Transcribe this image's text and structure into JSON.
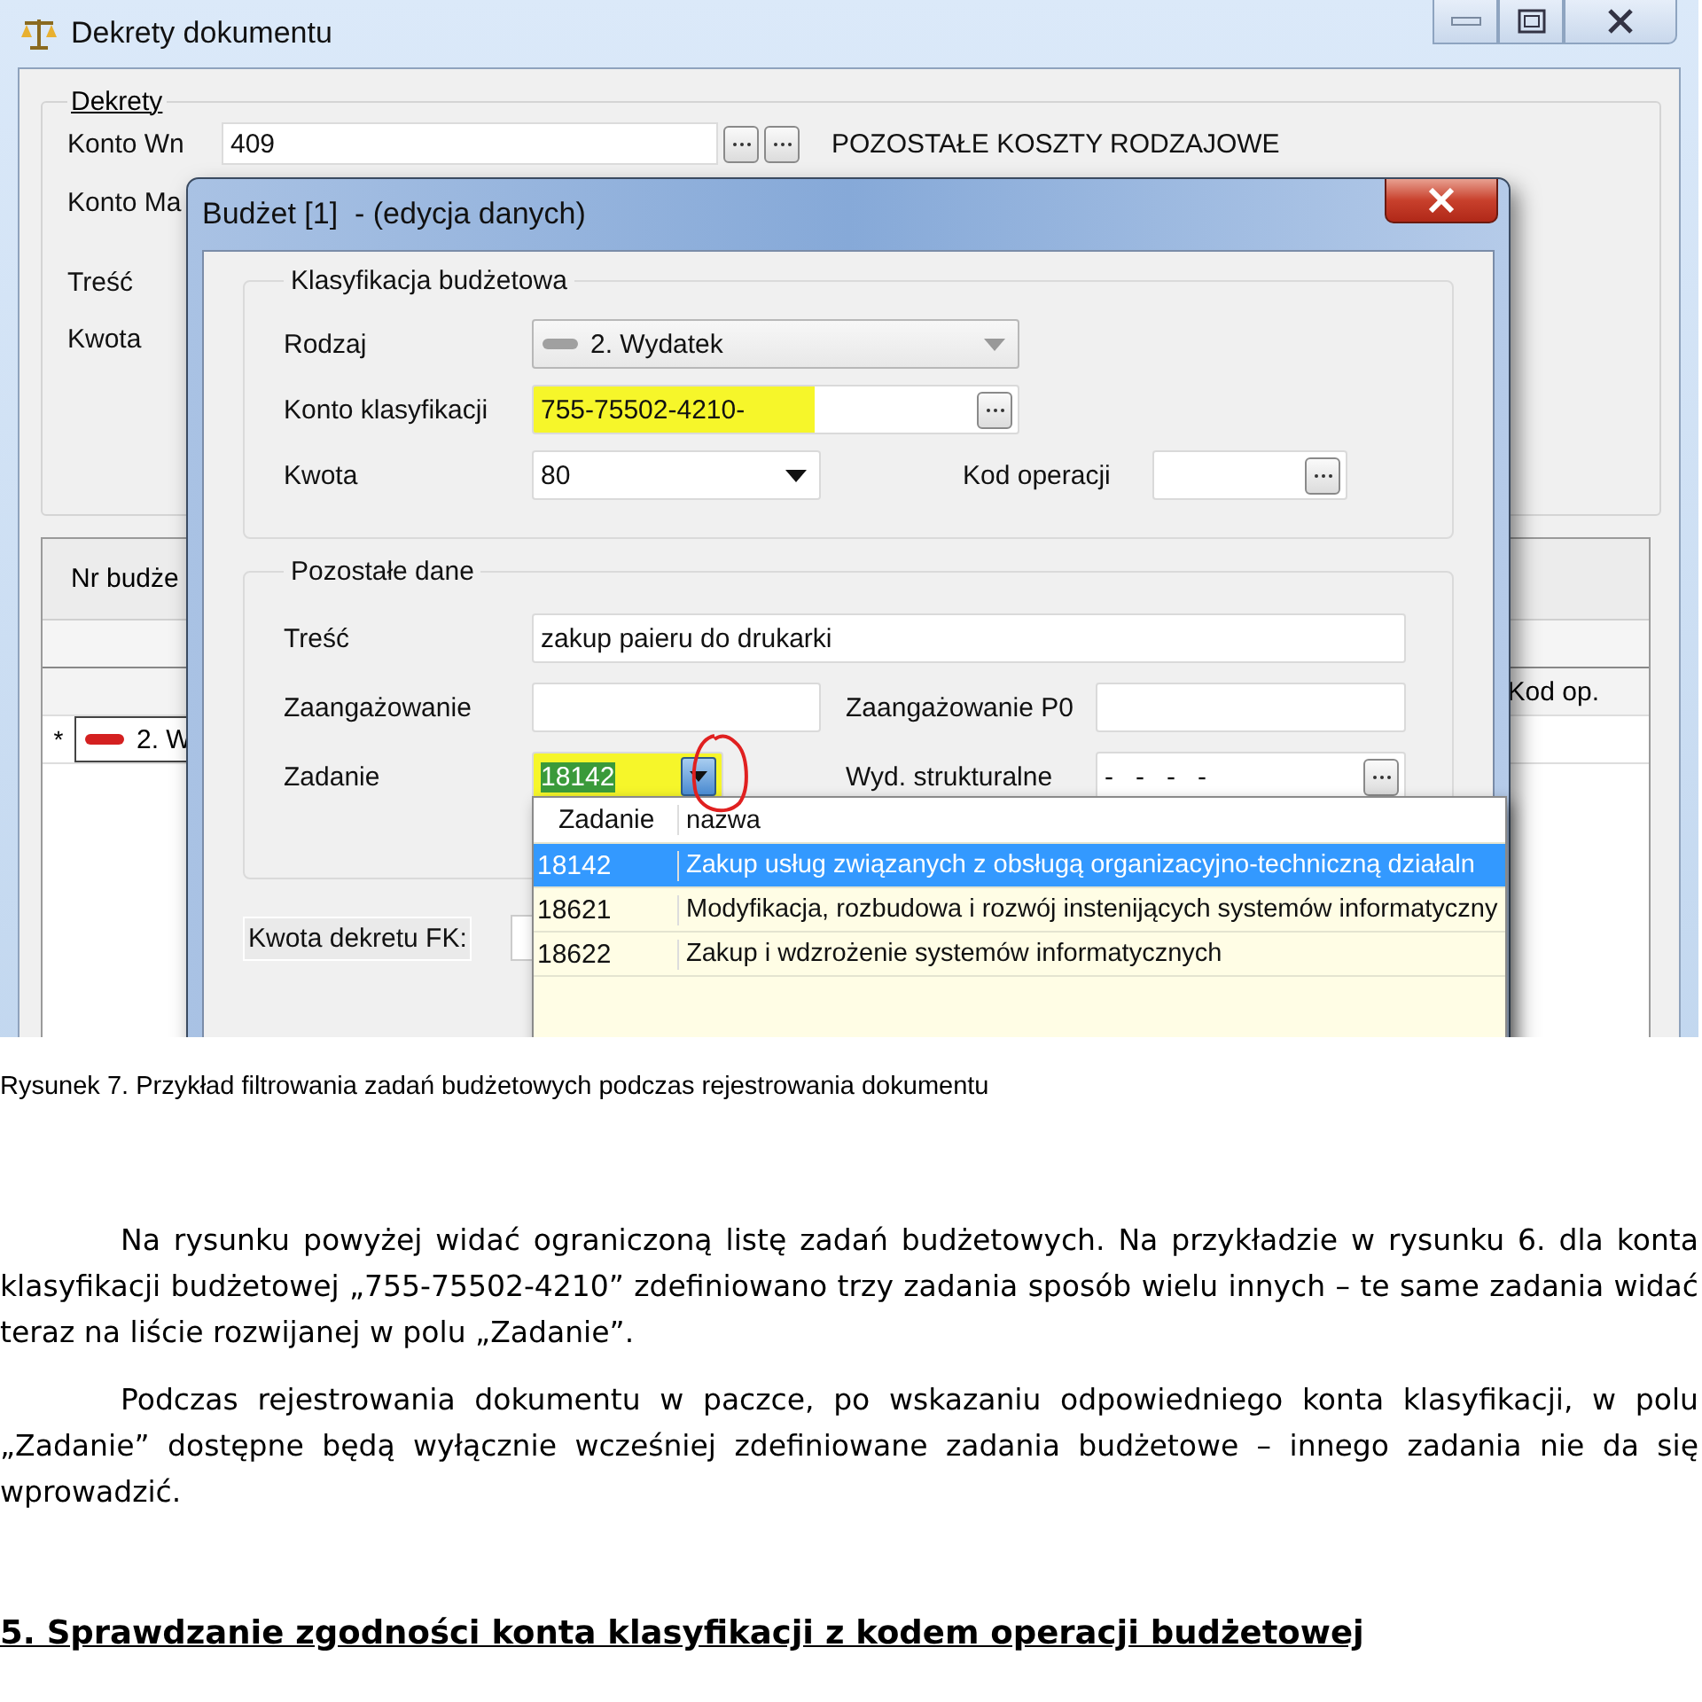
{
  "main_window": {
    "title": "Dekrety dokumentu",
    "group_title": "Dekrety",
    "labels": [
      "Konto Wn",
      "Konto Ma",
      "Treść",
      "Kwota"
    ],
    "konto_wn": "409",
    "konto_wn_name": "POZOSTAŁE KOSZTY RODZAJOWE",
    "grid": {
      "column_1": "Nr budże",
      "column_2": "Kod op.",
      "row_marker": "*",
      "row_cell": "2. W"
    }
  },
  "dialog": {
    "title": "Budżet [1]  - (edycja danych)",
    "sections": [
      {
        "title": "Klasyfikacja budżetowa",
        "rows": [
          {
            "label": "Rodzaj",
            "field": {
              "kind": "icon_combo",
              "value": "2. Wydatek",
              "disabled": true
            }
          },
          {
            "label": "Konto klasyfikacji",
            "field": {
              "kind": "lookup",
              "value": "755-75502-4210-",
              "highlighted": true
            }
          },
          {
            "label": "Kwota",
            "field": {
              "kind": "combo",
              "value": "80"
            },
            "label_2": "Kod operacji",
            "field_2": {
              "kind": "lookup"
            }
          }
        ]
      },
      {
        "title": "Pozostałe dane",
        "rows": [
          {
            "label": "Treść",
            "field": {
              "kind": "text",
              "value": "zakup paieru do drukarki"
            }
          },
          {
            "label": "Zaangażowanie",
            "field": {
              "kind": "text"
            },
            "label_2": "Zaangażowanie P0",
            "field_2": {
              "kind": "text"
            }
          },
          {
            "label": "Zadanie",
            "field": {
              "kind": "combo",
              "value": "18142",
              "highlighted": true,
              "open": true,
              "text_selected": true,
              "circled": true
            },
            "label_2": "Wyd. strukturalne",
            "field_2": {
              "kind": "lookup",
              "value": "-   -   -   -"
            }
          }
        ]
      }
    ],
    "footer_label": "Kwota dekretu FK:",
    "dropdown": {
      "columns": [
        "Zadanie",
        "nazwa"
      ],
      "rows": [
        {
          "cells": [
            "18142",
            "Zakup usług związanych z obsługą organizacyjno-techniczną działaln"
          ],
          "selected": true
        },
        {
          "cells": [
            "18621",
            "Modyfikacja, rozbudowa i rozwój instenijących systemów informatyczny"
          ],
          "selected": false
        },
        {
          "cells": [
            "18622",
            "Zakup i wdzrożenie systemów informatycznych"
          ],
          "selected": false
        }
      ]
    }
  },
  "document": {
    "caption": "Rysunek 7. Przykład filtrowania zadań budżetowych podczas rejestrowania dokumentu",
    "paragraphs": [
      "Na rysunku powyżej widać ograniczoną listę zadań budżetowych.  Na przykładzie w rysunku 6. dla konta klasyfikacji budżetowej „755-75502-4210” zdefiniowano trzy zadania sposób wielu innych – te same zadania widać teraz  na liście rozwijanej w polu „Zadanie”.",
      "Podczas rejestrowania dokumentu w paczce, po wskazaniu odpowiedniego konta klasyfikacji, w polu „Zadanie” dostępne będą wyłącznie wcześniej zdefiniowane zadania budżetowe – innego zadania nie da się wprowadzić."
    ],
    "heading": "5. Sprawdzanie zgodności konta klasyfikacji z kodem operacji budżetowej"
  }
}
